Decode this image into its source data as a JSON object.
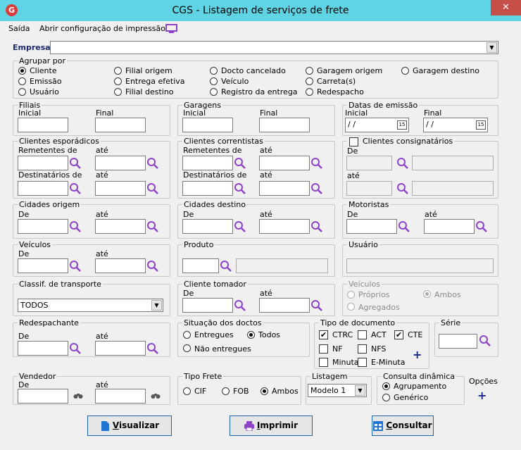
{
  "window": {
    "title": "CGS - Listagem de serviços de frete",
    "close": "✕"
  },
  "menu": {
    "saida": "Saída",
    "abrir": "Abrir configuração de impressão"
  },
  "empresa": {
    "label": "Empresa",
    "value": ""
  },
  "agrupar": {
    "legend": "Agrupar por",
    "options": [
      "Cliente",
      "Emissão",
      "Usuário",
      "Filial origem",
      "Entrega efetiva",
      "Filial destino",
      "Docto cancelado",
      "Veículo",
      "Registro da entrega",
      "Garagem origem",
      "Carreta(s)",
      "Redespacho",
      "Garagem destino"
    ],
    "selected": "Cliente"
  },
  "filiais": {
    "legend": "Filiais",
    "inicial": "Inicial",
    "final": "Final"
  },
  "garagens": {
    "legend": "Garagens",
    "inicial": "Inicial",
    "final": "Final"
  },
  "datas": {
    "legend": "Datas de emissão",
    "inicial": "Inicial",
    "final": "Final",
    "inicial_value": " / /",
    "final_value": " / /",
    "cal": "15"
  },
  "clientes_esp": {
    "legend": "Clientes esporádicos",
    "rem": "Remetentes  de",
    "ate1": "até",
    "dest": "Destinatários  de",
    "ate2": "até"
  },
  "clientes_corr": {
    "legend": "Clientes correntistas",
    "rem": "Remetentes  de",
    "ate1": "até",
    "dest": "Destinatários  de",
    "ate2": "até"
  },
  "clientes_cons": {
    "legend": "Clientes consignatários",
    "de": "De",
    "ate": "até"
  },
  "cidades_origem": {
    "legend": "Cidades origem",
    "de": "De",
    "ate": "até"
  },
  "cidades_destino": {
    "legend": "Cidades destino",
    "de": "De",
    "ate": "até"
  },
  "motoristas": {
    "legend": "Motoristas",
    "de": "De",
    "ate": "até"
  },
  "veiculos1": {
    "legend": "Veículos",
    "de": "De",
    "ate": "até"
  },
  "produto": {
    "legend": "Produto"
  },
  "usuario": {
    "legend": "Usuário"
  },
  "classif": {
    "legend": "Classif. de transporte",
    "value": "TODOS"
  },
  "cliente_tomador": {
    "legend": "Cliente tomador",
    "de": "De",
    "ate": "até"
  },
  "veiculos2": {
    "legend": "Veículos",
    "proprios": "Próprios",
    "ambos": "Ambos",
    "agregados": "Agregados"
  },
  "redespachante": {
    "legend": "Redespachante",
    "de": "De",
    "ate": "até"
  },
  "situacao": {
    "legend": "Situação dos doctos",
    "entregues": "Entregues",
    "todos": "Todos",
    "nao": "Não entregues"
  },
  "tipo_doc": {
    "legend": "Tipo de documento",
    "ctrc": "CTRC",
    "act": "ACT",
    "cte": "CTE",
    "nf": "NF",
    "nfs": "NFS",
    "minuta": "Minuta",
    "eminuta": "E-Minuta",
    "plus": "+"
  },
  "serie": {
    "legend": "Série"
  },
  "vendedor": {
    "legend": "Vendedor",
    "de": "De",
    "ate": "até"
  },
  "tipo_frete": {
    "legend": "Tipo Frete",
    "cif": "CIF",
    "fob": "FOB",
    "ambos": "Ambos"
  },
  "listagem": {
    "legend": "Listagem",
    "value": "Modelo 1"
  },
  "consulta": {
    "legend": "Consulta dinâmica",
    "agrup": "Agrupamento",
    "generico": "Genérico"
  },
  "opcoes": {
    "label": "Opções",
    "plus": "+"
  },
  "buttons": {
    "visualizar_u": "V",
    "visualizar": "isualizar",
    "imprimir_u": "I",
    "imprimir": "mprimir",
    "consultar_u": "C",
    "consultar": "onsultar"
  },
  "colors": {
    "titlebar": "#5fd4e4",
    "close": "#c74f49",
    "button_border": "#1c63b4",
    "magnifier": "#8e44c9"
  }
}
